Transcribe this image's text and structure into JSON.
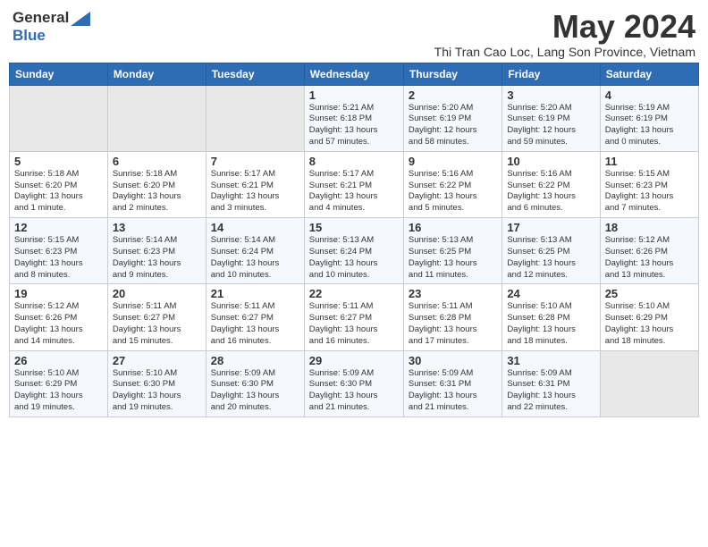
{
  "header": {
    "logo_general": "General",
    "logo_blue": "Blue",
    "month_title": "May 2024",
    "location": "Thi Tran Cao Loc, Lang Son Province, Vietnam"
  },
  "days_of_week": [
    "Sunday",
    "Monday",
    "Tuesday",
    "Wednesday",
    "Thursday",
    "Friday",
    "Saturday"
  ],
  "weeks": [
    {
      "days": [
        {
          "num": "",
          "info": ""
        },
        {
          "num": "",
          "info": ""
        },
        {
          "num": "",
          "info": ""
        },
        {
          "num": "1",
          "info": "Sunrise: 5:21 AM\nSunset: 6:18 PM\nDaylight: 13 hours\nand 57 minutes."
        },
        {
          "num": "2",
          "info": "Sunrise: 5:20 AM\nSunset: 6:19 PM\nDaylight: 12 hours\nand 58 minutes."
        },
        {
          "num": "3",
          "info": "Sunrise: 5:20 AM\nSunset: 6:19 PM\nDaylight: 12 hours\nand 59 minutes."
        },
        {
          "num": "4",
          "info": "Sunrise: 5:19 AM\nSunset: 6:19 PM\nDaylight: 13 hours\nand 0 minutes."
        }
      ]
    },
    {
      "days": [
        {
          "num": "5",
          "info": "Sunrise: 5:18 AM\nSunset: 6:20 PM\nDaylight: 13 hours\nand 1 minute."
        },
        {
          "num": "6",
          "info": "Sunrise: 5:18 AM\nSunset: 6:20 PM\nDaylight: 13 hours\nand 2 minutes."
        },
        {
          "num": "7",
          "info": "Sunrise: 5:17 AM\nSunset: 6:21 PM\nDaylight: 13 hours\nand 3 minutes."
        },
        {
          "num": "8",
          "info": "Sunrise: 5:17 AM\nSunset: 6:21 PM\nDaylight: 13 hours\nand 4 minutes."
        },
        {
          "num": "9",
          "info": "Sunrise: 5:16 AM\nSunset: 6:22 PM\nDaylight: 13 hours\nand 5 minutes."
        },
        {
          "num": "10",
          "info": "Sunrise: 5:16 AM\nSunset: 6:22 PM\nDaylight: 13 hours\nand 6 minutes."
        },
        {
          "num": "11",
          "info": "Sunrise: 5:15 AM\nSunset: 6:23 PM\nDaylight: 13 hours\nand 7 minutes."
        }
      ]
    },
    {
      "days": [
        {
          "num": "12",
          "info": "Sunrise: 5:15 AM\nSunset: 6:23 PM\nDaylight: 13 hours\nand 8 minutes."
        },
        {
          "num": "13",
          "info": "Sunrise: 5:14 AM\nSunset: 6:23 PM\nDaylight: 13 hours\nand 9 minutes."
        },
        {
          "num": "14",
          "info": "Sunrise: 5:14 AM\nSunset: 6:24 PM\nDaylight: 13 hours\nand 10 minutes."
        },
        {
          "num": "15",
          "info": "Sunrise: 5:13 AM\nSunset: 6:24 PM\nDaylight: 13 hours\nand 10 minutes."
        },
        {
          "num": "16",
          "info": "Sunrise: 5:13 AM\nSunset: 6:25 PM\nDaylight: 13 hours\nand 11 minutes."
        },
        {
          "num": "17",
          "info": "Sunrise: 5:13 AM\nSunset: 6:25 PM\nDaylight: 13 hours\nand 12 minutes."
        },
        {
          "num": "18",
          "info": "Sunrise: 5:12 AM\nSunset: 6:26 PM\nDaylight: 13 hours\nand 13 minutes."
        }
      ]
    },
    {
      "days": [
        {
          "num": "19",
          "info": "Sunrise: 5:12 AM\nSunset: 6:26 PM\nDaylight: 13 hours\nand 14 minutes."
        },
        {
          "num": "20",
          "info": "Sunrise: 5:11 AM\nSunset: 6:27 PM\nDaylight: 13 hours\nand 15 minutes."
        },
        {
          "num": "21",
          "info": "Sunrise: 5:11 AM\nSunset: 6:27 PM\nDaylight: 13 hours\nand 16 minutes."
        },
        {
          "num": "22",
          "info": "Sunrise: 5:11 AM\nSunset: 6:27 PM\nDaylight: 13 hours\nand 16 minutes."
        },
        {
          "num": "23",
          "info": "Sunrise: 5:11 AM\nSunset: 6:28 PM\nDaylight: 13 hours\nand 17 minutes."
        },
        {
          "num": "24",
          "info": "Sunrise: 5:10 AM\nSunset: 6:28 PM\nDaylight: 13 hours\nand 18 minutes."
        },
        {
          "num": "25",
          "info": "Sunrise: 5:10 AM\nSunset: 6:29 PM\nDaylight: 13 hours\nand 18 minutes."
        }
      ]
    },
    {
      "days": [
        {
          "num": "26",
          "info": "Sunrise: 5:10 AM\nSunset: 6:29 PM\nDaylight: 13 hours\nand 19 minutes."
        },
        {
          "num": "27",
          "info": "Sunrise: 5:10 AM\nSunset: 6:30 PM\nDaylight: 13 hours\nand 19 minutes."
        },
        {
          "num": "28",
          "info": "Sunrise: 5:09 AM\nSunset: 6:30 PM\nDaylight: 13 hours\nand 20 minutes."
        },
        {
          "num": "29",
          "info": "Sunrise: 5:09 AM\nSunset: 6:30 PM\nDaylight: 13 hours\nand 21 minutes."
        },
        {
          "num": "30",
          "info": "Sunrise: 5:09 AM\nSunset: 6:31 PM\nDaylight: 13 hours\nand 21 minutes."
        },
        {
          "num": "31",
          "info": "Sunrise: 5:09 AM\nSunset: 6:31 PM\nDaylight: 13 hours\nand 22 minutes."
        },
        {
          "num": "",
          "info": ""
        }
      ]
    }
  ]
}
